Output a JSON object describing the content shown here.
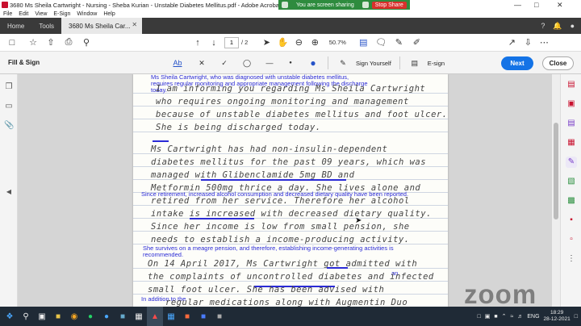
{
  "window": {
    "title": "3680 Ms Sheila Cartwright - Nursing - Sheba Kurian - Unstable Diabetes Mellitus.pdf - Adobe Acrobat Pro DC (32-bit)"
  },
  "screen_share": {
    "status_text": "You are screen sharing",
    "stop_label": "Stop Share"
  },
  "menu": [
    "File",
    "Edit",
    "View",
    "E-Sign",
    "Window",
    "Help"
  ],
  "tabs": {
    "home": "Home",
    "tools": "Tools",
    "document": "3680 Ms Sheila Car..."
  },
  "toolbar": {
    "page_current": "1",
    "page_total": "/ 2",
    "zoom_level": "50.7%"
  },
  "fill_sign": {
    "title": "Fill & Sign",
    "text_tool": "Ab",
    "sign_yourself": "Sign Yourself",
    "esign": "E-sign",
    "next": "Next",
    "close": "Close",
    "accent_color": "#2552c8"
  },
  "document": {
    "typed_notes": [
      "Ms Sheila Cartwright, who was diagnosed with unstable diabetes mellitus, requires regular monitoring and appropriate management following the discharge today.",
      "Since retirement, increased alcohol consumption and decreased dietary quality have been reported.",
      "She survives on a meagre pension, and therefore, establishing income-generating activities is recommended.",
      "an",
      "In addition to the"
    ],
    "handwritten_lines": [
      "I am informing you regarding Ms Sheila Cartwright",
      "who requires ongoing monitoring and management",
      "because of unstable diabetes mellitus and foot ulcer.",
      "She is being discharged today.",
      "Ms Cartwright has had non-insulin-dependent",
      "diabetes mellitus for the past 09 years, which was",
      "managed with Glibenclamide 5mg BD and",
      "Metformin 500mg thrice a day. She lives alone and",
      "retired from her service. Therefore her alcohol",
      "intake is increased with decreased dietary quality.",
      "Since her income is low from small pension, she",
      "needs to establish a income-producing activity.",
      "On 14 April 2017, Ms Cartwright got admitted with",
      "the complaints of uncontrolled diabetes and infected",
      "small foot ulcer. She has been advised with",
      "regular medications along with Augmentin Duo"
    ],
    "ink_color": "#2b2bd6"
  },
  "watermark": {
    "brand": "zoom"
  },
  "taskbar": {
    "language": "ENG",
    "time": "18:29",
    "date": "28-12-2021"
  }
}
